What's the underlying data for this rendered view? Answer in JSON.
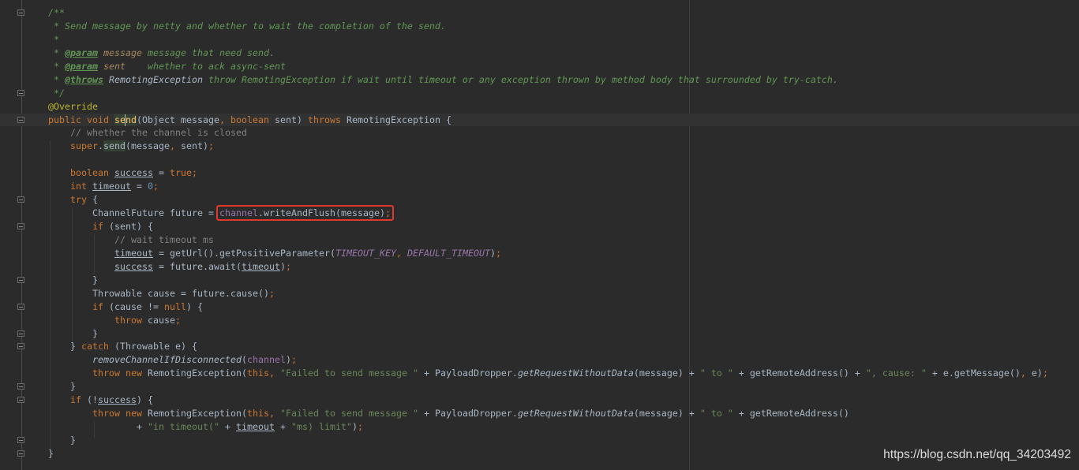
{
  "editor": {
    "caret_line": 8,
    "fold_lines": [
      0,
      6,
      8,
      14,
      16,
      20,
      22,
      24,
      25,
      28,
      29,
      32,
      33
    ],
    "boxed_line": 15,
    "highlight_box_color": "#e0392b",
    "lines": [
      [
        [
          "/**",
          "d"
        ]
      ],
      [
        [
          " * Send message by netty and whether to wait the completion of the send.",
          "d"
        ]
      ],
      [
        [
          " *",
          "d"
        ]
      ],
      [
        [
          " * ",
          "d"
        ],
        [
          "@param",
          "dt"
        ],
        [
          " message",
          "dp"
        ],
        [
          " message that need send.",
          "d"
        ]
      ],
      [
        [
          " * ",
          "d"
        ],
        [
          "@param",
          "dt"
        ],
        [
          " sent",
          "dp"
        ],
        [
          "    whether to ack async-sent",
          "d"
        ]
      ],
      [
        [
          " * ",
          "d"
        ],
        [
          "@throws",
          "dt"
        ],
        [
          " RemotingException",
          "dr"
        ],
        [
          " throw RemotingException if wait until timeout or any exception thrown by method body that surrounded by try-catch.",
          "d"
        ]
      ],
      [
        [
          " */",
          "d"
        ]
      ],
      [
        [
          "@Override",
          "a"
        ]
      ],
      [
        [
          "public void ",
          "k"
        ],
        [
          "send",
          "m"
        ],
        [
          "(Object message",
          "t"
        ],
        [
          ", ",
          "k"
        ],
        [
          "boolean ",
          "k"
        ],
        [
          "sent) ",
          "t"
        ],
        [
          "throws ",
          "k"
        ],
        [
          "RemotingException {",
          "t"
        ]
      ],
      [
        [
          "    // whether the channel is closed",
          "c"
        ]
      ],
      [
        [
          "    ",
          "t"
        ],
        [
          "super",
          "k"
        ],
        [
          ".",
          "t"
        ],
        [
          "send",
          "t hu"
        ],
        [
          "(message",
          "t"
        ],
        [
          ", ",
          "k"
        ],
        [
          "sent)",
          "t"
        ],
        [
          ";",
          "k"
        ]
      ],
      [],
      [
        [
          "    boolean ",
          "k"
        ],
        [
          "success",
          "t u"
        ],
        [
          " = ",
          "t"
        ],
        [
          "true",
          "k"
        ],
        [
          ";",
          "k"
        ]
      ],
      [
        [
          "    int ",
          "k"
        ],
        [
          "timeout",
          "t u"
        ],
        [
          " = ",
          "t"
        ],
        [
          "0",
          "n"
        ],
        [
          ";",
          "k"
        ]
      ],
      [
        [
          "    try ",
          "k"
        ],
        [
          "{",
          "t"
        ]
      ],
      [
        [
          "        ChannelFuture future = ",
          "t"
        ],
        [
          "channel",
          "f",
          1
        ],
        [
          ".writeAndFlush(message)",
          "t",
          1
        ],
        [
          ";",
          "k",
          1
        ]
      ],
      [
        [
          "        if ",
          "k"
        ],
        [
          "(sent) {",
          "t"
        ]
      ],
      [
        [
          "            // wait timeout ms",
          "c"
        ]
      ],
      [
        [
          "            ",
          "t"
        ],
        [
          "timeout",
          "t u"
        ],
        [
          " = getUrl().getPositiveParameter(",
          "t"
        ],
        [
          "TIMEOUT_KEY",
          "fi"
        ],
        [
          ", ",
          "k"
        ],
        [
          "DEFAULT_TIMEOUT",
          "fi"
        ],
        [
          ")",
          "t"
        ],
        [
          ";",
          "k"
        ]
      ],
      [
        [
          "            ",
          "t"
        ],
        [
          "success",
          "t u"
        ],
        [
          " = future.await(",
          "t"
        ],
        [
          "timeout",
          "t u"
        ],
        [
          ")",
          "t"
        ],
        [
          ";",
          "k"
        ]
      ],
      [
        [
          "        }",
          "t"
        ]
      ],
      [
        [
          "        Throwable cause = future.cause()",
          "t"
        ],
        [
          ";",
          "k"
        ]
      ],
      [
        [
          "        if ",
          "k"
        ],
        [
          "(cause != ",
          "t"
        ],
        [
          "null",
          "k"
        ],
        [
          ") {",
          "t"
        ]
      ],
      [
        [
          "            throw ",
          "k"
        ],
        [
          "cause",
          "t"
        ],
        [
          ";",
          "k"
        ]
      ],
      [
        [
          "        }",
          "t"
        ]
      ],
      [
        [
          "    } ",
          "t"
        ],
        [
          "catch ",
          "k"
        ],
        [
          "(Throwable e) {",
          "t"
        ]
      ],
      [
        [
          "        ",
          "t"
        ],
        [
          "removeChannelIfDisconnected",
          "t i"
        ],
        [
          "(",
          "t"
        ],
        [
          "channel",
          "f"
        ],
        [
          ")",
          "t"
        ],
        [
          ";",
          "k"
        ]
      ],
      [
        [
          "        throw new ",
          "k"
        ],
        [
          "RemotingException(",
          "t"
        ],
        [
          "this",
          "k"
        ],
        [
          ", ",
          "k"
        ],
        [
          "\"Failed to send message \"",
          "s"
        ],
        [
          " + PayloadDropper.",
          "t"
        ],
        [
          "getRequestWithoutData",
          "t i"
        ],
        [
          "(message) + ",
          "t"
        ],
        [
          "\" to \"",
          "s"
        ],
        [
          " + getRemoteAddress() + ",
          "t"
        ],
        [
          "\", cause: \"",
          "s"
        ],
        [
          " + e.getMessage()",
          "t"
        ],
        [
          ", ",
          "k"
        ],
        [
          "e)",
          "t"
        ],
        [
          ";",
          "k"
        ]
      ],
      [
        [
          "    }",
          "t"
        ]
      ],
      [
        [
          "    if ",
          "k"
        ],
        [
          "(!",
          "t"
        ],
        [
          "success",
          "t u"
        ],
        [
          ") {",
          "t"
        ]
      ],
      [
        [
          "        throw new ",
          "k"
        ],
        [
          "RemotingException(",
          "t"
        ],
        [
          "this",
          "k"
        ],
        [
          ", ",
          "k"
        ],
        [
          "\"Failed to send message \"",
          "s"
        ],
        [
          " + PayloadDropper.",
          "t"
        ],
        [
          "getRequestWithoutData",
          "t i"
        ],
        [
          "(message) + ",
          "t"
        ],
        [
          "\" to \"",
          "s"
        ],
        [
          " + getRemoteAddress()",
          "t"
        ]
      ],
      [
        [
          "                + ",
          "t"
        ],
        [
          "\"in timeout(\"",
          "s"
        ],
        [
          " + ",
          "t"
        ],
        [
          "timeout",
          "t u"
        ],
        [
          " + ",
          "t"
        ],
        [
          "\"ms) limit\"",
          "s"
        ],
        [
          ")",
          "t"
        ],
        [
          ";",
          "k"
        ]
      ],
      [
        [
          "    }",
          "t"
        ]
      ],
      [
        [
          "}",
          "t"
        ]
      ]
    ]
  },
  "watermark": "https://blog.csdn.net/qq_34203492"
}
